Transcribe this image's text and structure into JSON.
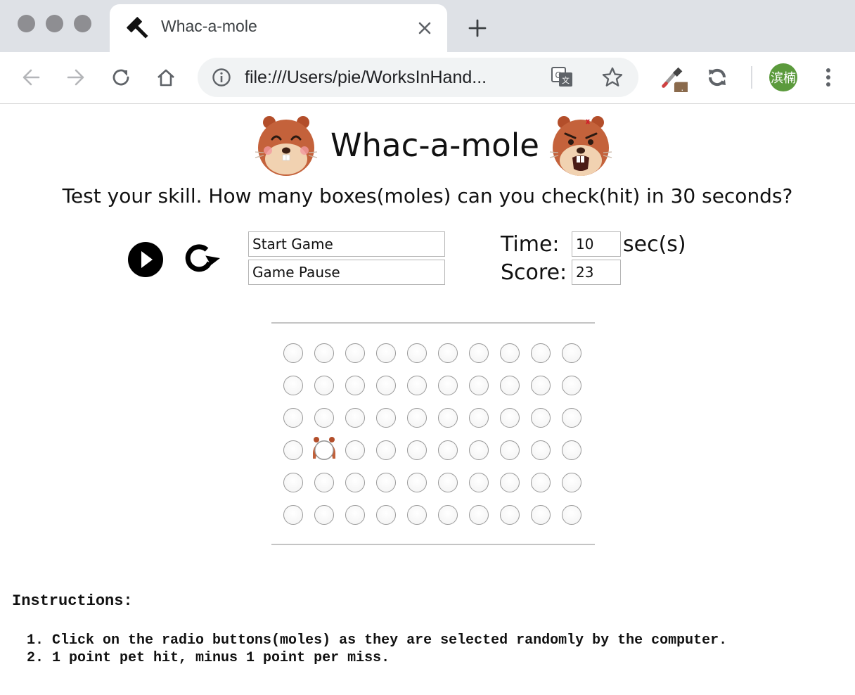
{
  "browser": {
    "tab_title": "Whac-a-mole",
    "tab_favicon": "hammer-icon",
    "address_url": "file:///Users/pie/WorksInHand...",
    "profile_initials": "滨楠",
    "extension_badge": "."
  },
  "page": {
    "title": "Whac-a-mole",
    "subtitle": "Test your skill. How many boxes(moles) can you check(hit) in 30 seconds?",
    "controls": {
      "play_icon": "play-icon",
      "restart_icon": "restart-icon",
      "start_field": "Start Game",
      "pause_field": "Game Pause"
    },
    "stats": {
      "time_label": "Time:",
      "time_value": "10",
      "time_unit": "sec(s)",
      "score_label": "Score:",
      "score_value": "23"
    },
    "board": {
      "rows": 6,
      "cols": 10,
      "mole_row": 3,
      "mole_col": 1
    },
    "instructions": {
      "heading": "Instructions:",
      "items": [
        "1. Click on the radio buttons(moles) as they are selected randomly by the computer.",
        "2. 1 point pet hit, minus 1 point per miss."
      ]
    }
  },
  "colors": {
    "mole_fur": "#c0603a",
    "mole_muzzle": "#f3d6b8",
    "avatar": "#5b9a3c"
  }
}
